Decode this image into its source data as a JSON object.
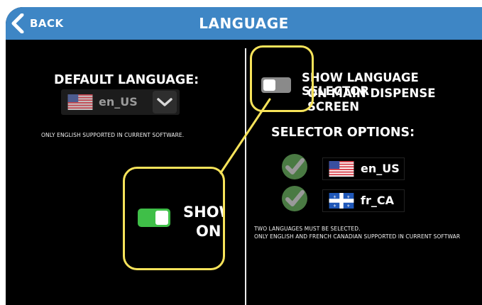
{
  "header": {
    "back_label": "BACK",
    "title": "LANGUAGE",
    "bar_color": "#3e86c5"
  },
  "left": {
    "heading": "DEFAULT LANGUAGE:",
    "dropdown": {
      "selected": "en_US",
      "flag": "us-flag-icon"
    },
    "note": "ONLY ENGLISH SUPPORTED IN CURRENT SOFTWARE."
  },
  "right": {
    "toggle_line1": "SHOW LANGUAGE SELECTOR",
    "toggle_line2": "ON MAIN DISPENSE SCREEN",
    "toggle_on": false,
    "options_heading": "SELECTOR OPTIONS:",
    "options": [
      {
        "code": "en_US",
        "checked": true,
        "flag": "us-flag-icon"
      },
      {
        "code": "fr_CA",
        "checked": true,
        "flag": "quebec-flag-icon"
      }
    ],
    "note_line1": "TWO LANGUAGES MUST BE SELECTED.",
    "note_line2": "ONLY ENGLISH AND FRENCH CANADIAN SUPPORTED IN CURRENT SOFTWAR"
  },
  "zoom_callout": {
    "text_line1": "SHOW",
    "text_line2": "ON M",
    "toggle_on": true,
    "highlight_color": "#f7e35a",
    "on_color": "#3fbf48"
  }
}
